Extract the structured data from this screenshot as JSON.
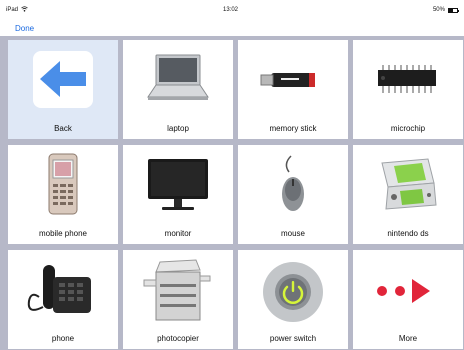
{
  "status": {
    "device": "iPad",
    "time": "13:02",
    "battery": "50%"
  },
  "nav": {
    "done_label": "Done"
  },
  "tiles": [
    {
      "label": "Back",
      "icon": "back-arrow-icon"
    },
    {
      "label": "laptop",
      "icon": "laptop-icon"
    },
    {
      "label": "memory stick",
      "icon": "memory-stick-icon"
    },
    {
      "label": "microchip",
      "icon": "microchip-icon"
    },
    {
      "label": "mobile phone",
      "icon": "mobile-phone-icon"
    },
    {
      "label": "monitor",
      "icon": "monitor-icon"
    },
    {
      "label": "mouse",
      "icon": "mouse-icon"
    },
    {
      "label": "nintendo ds",
      "icon": "nintendo-ds-icon"
    },
    {
      "label": "phone",
      "icon": "desk-phone-icon"
    },
    {
      "label": "photocopier",
      "icon": "photocopier-icon"
    },
    {
      "label": "power switch",
      "icon": "power-switch-icon"
    },
    {
      "label": "More",
      "icon": "more-arrow-icon"
    }
  ],
  "colors": {
    "accent": "#1b6ae0",
    "grid_bg": "#b6b8c8",
    "back_tile": "#dfe8f6",
    "more_red": "#e1253a",
    "back_arrow": "#4a8ee8"
  }
}
